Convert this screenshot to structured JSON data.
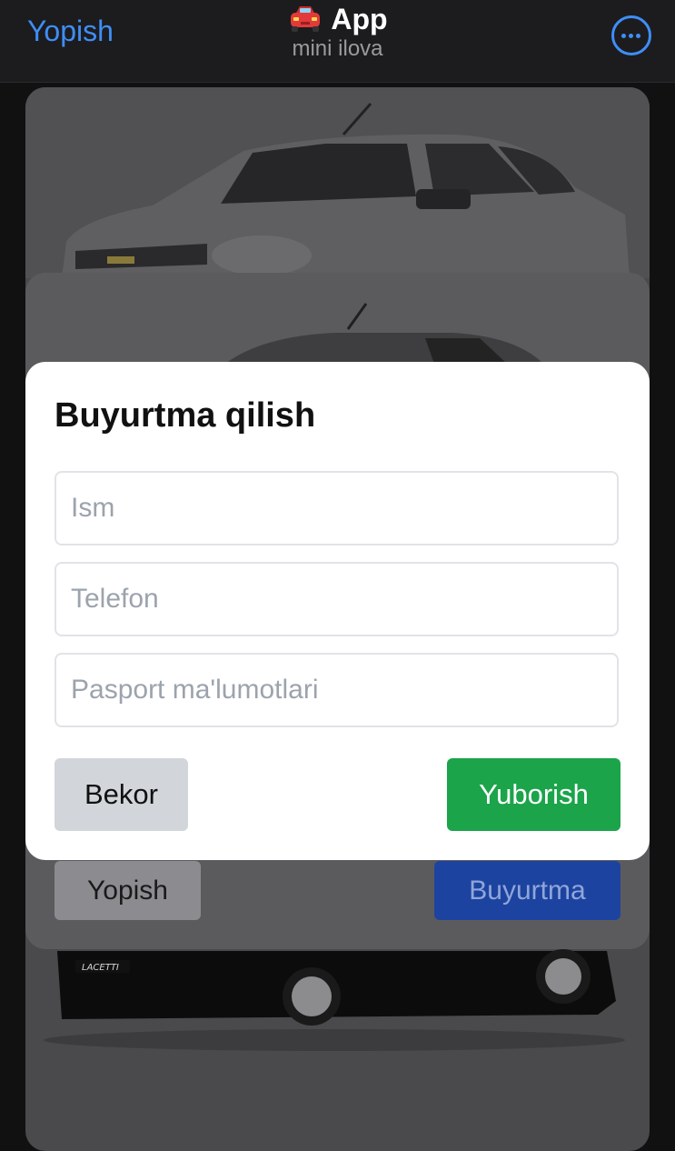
{
  "header": {
    "close_label": "Yopish",
    "title": "App",
    "subtitle": "mini ilova",
    "title_icon": "red-car-emoji",
    "menu_icon": "more-dots-icon"
  },
  "background": {
    "close_button_label": "Yopish",
    "order_button_label": "Buyurtma",
    "car_badge": "LACETTI"
  },
  "modal": {
    "title": "Buyurtma qilish",
    "fields": {
      "name_placeholder": "Ism",
      "phone_placeholder": "Telefon",
      "passport_placeholder": "Pasport ma'lumotlari"
    },
    "cancel_label": "Bekor",
    "submit_label": "Yuborish"
  },
  "colors": {
    "accent_blue": "#3e8ef7",
    "submit_green": "#1ba44a",
    "order_blue": "#1d43a0"
  }
}
